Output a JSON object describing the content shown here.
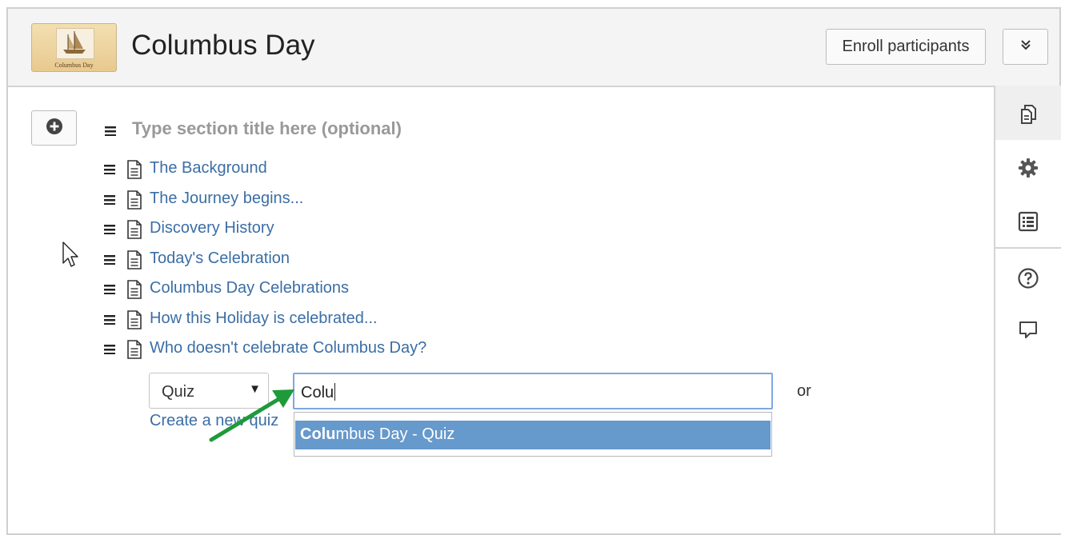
{
  "course": {
    "title": "Columbus Day",
    "thumbnail_caption": "Columbus Day",
    "enroll_label": "Enroll participants",
    "more_icon": "chevron-double-down-icon"
  },
  "section": {
    "title_placeholder": "Type section title here (optional)",
    "items": [
      {
        "label": "The Background",
        "icon": "page-icon"
      },
      {
        "label": "The Journey begins...",
        "icon": "page-icon"
      },
      {
        "label": "Discovery History",
        "icon": "page-icon"
      },
      {
        "label": "Today's Celebration",
        "icon": "page-icon"
      },
      {
        "label": "Columbus Day Celebrations",
        "icon": "page-icon"
      },
      {
        "label": "How this Holiday is celebrated...",
        "icon": "page-icon"
      },
      {
        "label": "Who doesn't celebrate Columbus Day?",
        "icon": "page-icon"
      }
    ]
  },
  "add_activity": {
    "type_selected": "Quiz",
    "create_new_label": "Create a new quiz",
    "search_value": "Colu",
    "or_label": "or",
    "suggestion_match": "Colu",
    "suggestion_rest": "mbus Day - Quiz"
  },
  "drawer": {
    "icons": [
      "copy-pages-icon",
      "gear-icon",
      "list-icon",
      "help-icon",
      "comment-icon"
    ]
  },
  "colors": {
    "link": "#3b6ea5",
    "highlight": "#6699cc",
    "focus_border": "#7ea8e0",
    "annotation_arrow": "#1e9a3a"
  }
}
